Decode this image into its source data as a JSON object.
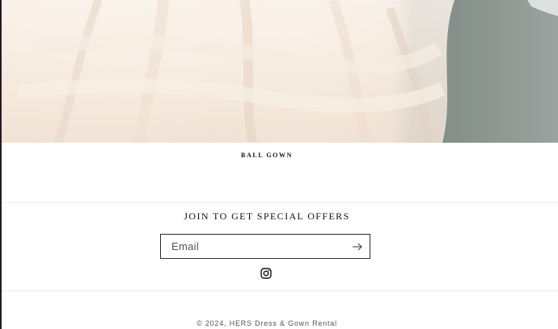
{
  "hero": {
    "image_name": "ball-gown-photo"
  },
  "product": {
    "caption": "BALL GOWN"
  },
  "newsletter": {
    "heading": "JOIN TO GET SPECIAL OFFERS",
    "email_placeholder": "Email",
    "email_value": "",
    "submit_icon": "arrow-right-icon"
  },
  "social": {
    "icon": "instagram-icon"
  },
  "footer": {
    "copyright": "© 2024, HERS Dress & Gown Rental"
  },
  "colors": {
    "background": "#ffffff",
    "text": "#111111",
    "border": "#2b2b2b",
    "divider": "#ececec"
  }
}
